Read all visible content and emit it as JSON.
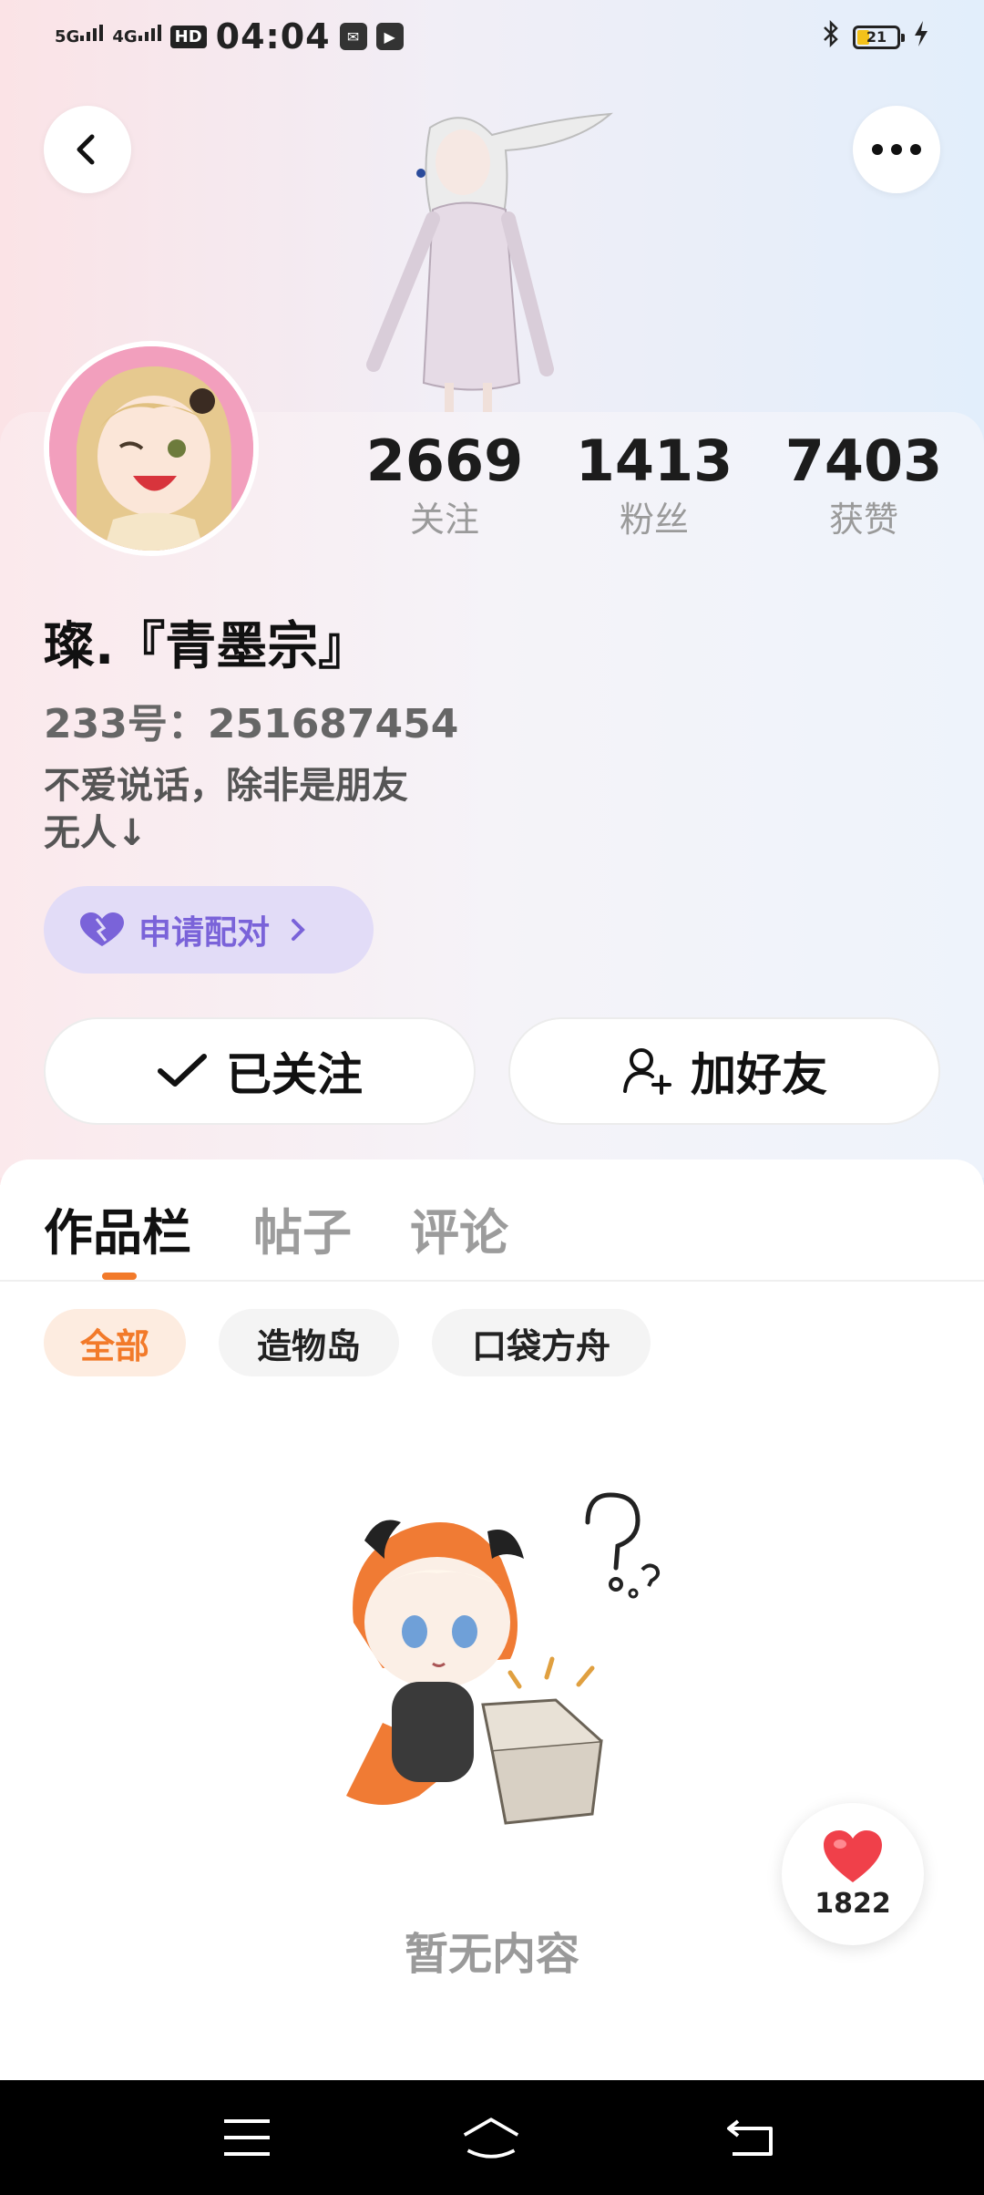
{
  "status_bar": {
    "signal_1": "5G",
    "signal_2": "4G",
    "hd": "HD",
    "time": "04:04",
    "battery": "21",
    "colors": {
      "battery_fill": "#f3c21a"
    }
  },
  "header": {
    "back_icon": "chevron-left-icon",
    "more_icon": "more-horizontal-icon"
  },
  "profile": {
    "stats": [
      {
        "value": "2669",
        "label": "关注"
      },
      {
        "value": "1413",
        "label": "粉丝"
      },
      {
        "value": "7403",
        "label": "获赞"
      }
    ],
    "nickname": "璨.『青墨宗』",
    "uid": "233号：251687454",
    "bio_line1": "不爱说话，除非是朋友",
    "bio_line2": "无人↓",
    "pair_button": "申请配对",
    "followed_button": "已关注",
    "add_friend_button": "加好友"
  },
  "tabs": [
    {
      "label": "作品栏",
      "active": true
    },
    {
      "label": "帖子",
      "active": false
    },
    {
      "label": "评论",
      "active": false
    }
  ],
  "filters": [
    {
      "label": "全部",
      "active": true
    },
    {
      "label": "造物岛",
      "active": false
    },
    {
      "label": "口袋方舟",
      "active": false
    }
  ],
  "empty_state": {
    "text": "暂无内容"
  },
  "like_fab": {
    "count": "1822",
    "icon": "heart-icon"
  },
  "colors": {
    "accent": "#f27a2a",
    "pair_purple": "#7a63d9",
    "heart_red": "#f0404a"
  }
}
